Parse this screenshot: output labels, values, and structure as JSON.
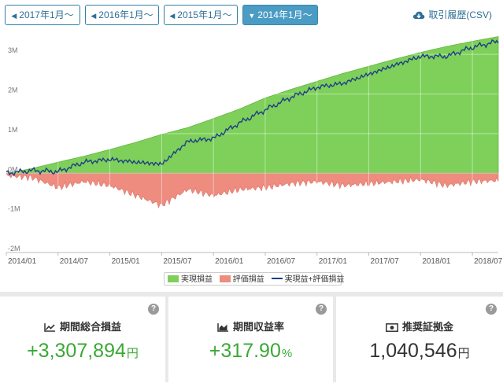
{
  "period_buttons": [
    {
      "label": "2017年1月〜",
      "active": false
    },
    {
      "label": "2016年1月〜",
      "active": false
    },
    {
      "label": "2015年1月〜",
      "active": false
    },
    {
      "label": "2014年1月〜",
      "active": true
    }
  ],
  "csv_link": {
    "label": "取引履歴(CSV)",
    "icon": "cloud-download-icon"
  },
  "colors": {
    "realized": "#7ed05a",
    "unrealized": "#ee8c80",
    "total_line": "#1f3f86",
    "accent": "#2f7fa9",
    "value_green": "#3aa935"
  },
  "chart_data": {
    "type": "area",
    "x_ticks": [
      "2014/01",
      "2014/07",
      "2015/01",
      "2015/07",
      "2016/01",
      "2016/07",
      "2017/01",
      "2017/07",
      "2018/01",
      "2018/07"
    ],
    "y_ticks": [
      "-2M",
      "-1M",
      "0M",
      "1M",
      "2M",
      "3M"
    ],
    "ylim": [
      -2000000,
      3500000
    ],
    "xlim": [
      "2014/01",
      "2018/10"
    ],
    "grid": true,
    "legend_position": "bottom-center",
    "series": [
      {
        "name": "実現損益",
        "kind": "area",
        "points": [
          [
            "2014/01",
            0
          ],
          [
            "2014/04",
            120000
          ],
          [
            "2014/07",
            280000
          ],
          [
            "2014/10",
            430000
          ],
          [
            "2015/01",
            600000
          ],
          [
            "2015/04",
            780000
          ],
          [
            "2015/07",
            980000
          ],
          [
            "2015/10",
            1150000
          ],
          [
            "2016/01",
            1380000
          ],
          [
            "2016/04",
            1620000
          ],
          [
            "2016/07",
            1900000
          ],
          [
            "2016/10",
            2120000
          ],
          [
            "2017/01",
            2320000
          ],
          [
            "2017/04",
            2520000
          ],
          [
            "2017/07",
            2700000
          ],
          [
            "2017/10",
            2880000
          ],
          [
            "2018/01",
            3050000
          ],
          [
            "2018/04",
            3200000
          ],
          [
            "2018/07",
            3330000
          ],
          [
            "2018/10",
            3450000
          ]
        ]
      },
      {
        "name": "評価損益",
        "kind": "area",
        "points": [
          [
            "2014/01",
            0
          ],
          [
            "2014/04",
            -50000
          ],
          [
            "2014/07",
            -300000
          ],
          [
            "2014/10",
            -150000
          ],
          [
            "2015/01",
            -250000
          ],
          [
            "2015/04",
            -500000
          ],
          [
            "2015/07",
            -750000
          ],
          [
            "2015/10",
            -350000
          ],
          [
            "2016/01",
            -500000
          ],
          [
            "2016/04",
            -350000
          ],
          [
            "2016/07",
            -300000
          ],
          [
            "2016/10",
            -200000
          ],
          [
            "2017/01",
            -150000
          ],
          [
            "2017/04",
            -250000
          ],
          [
            "2017/07",
            -200000
          ],
          [
            "2017/10",
            -150000
          ],
          [
            "2018/01",
            -100000
          ],
          [
            "2018/04",
            -250000
          ],
          [
            "2018/07",
            -150000
          ],
          [
            "2018/10",
            -120000
          ]
        ]
      },
      {
        "name": "実現益+評価損益",
        "kind": "line",
        "points": [
          [
            "2014/01",
            0
          ],
          [
            "2014/04",
            70000
          ],
          [
            "2014/07",
            40000
          ],
          [
            "2014/10",
            280000
          ],
          [
            "2015/01",
            350000
          ],
          [
            "2015/04",
            280000
          ],
          [
            "2015/07",
            230000
          ],
          [
            "2015/10",
            800000
          ],
          [
            "2016/01",
            880000
          ],
          [
            "2016/04",
            1270000
          ],
          [
            "2016/07",
            1600000
          ],
          [
            "2016/10",
            1920000
          ],
          [
            "2017/01",
            2170000
          ],
          [
            "2017/04",
            2270000
          ],
          [
            "2017/07",
            2500000
          ],
          [
            "2017/10",
            2730000
          ],
          [
            "2018/01",
            2950000
          ],
          [
            "2018/04",
            2950000
          ],
          [
            "2018/07",
            3180000
          ],
          [
            "2018/10",
            3330000
          ]
        ]
      }
    ]
  },
  "stats": [
    {
      "title": "期間総合損益",
      "icon": "line-chart-icon",
      "value": "+3,307,894",
      "unit": "円",
      "value_color": "green"
    },
    {
      "title": "期間収益率",
      "icon": "area-chart-icon",
      "value": "+317.90",
      "unit": "%",
      "value_color": "green"
    },
    {
      "title": "推奨証拠金",
      "icon": "money-icon",
      "value": "1,040,546",
      "unit": "円",
      "value_color": "dark"
    }
  ],
  "help_label": "?"
}
